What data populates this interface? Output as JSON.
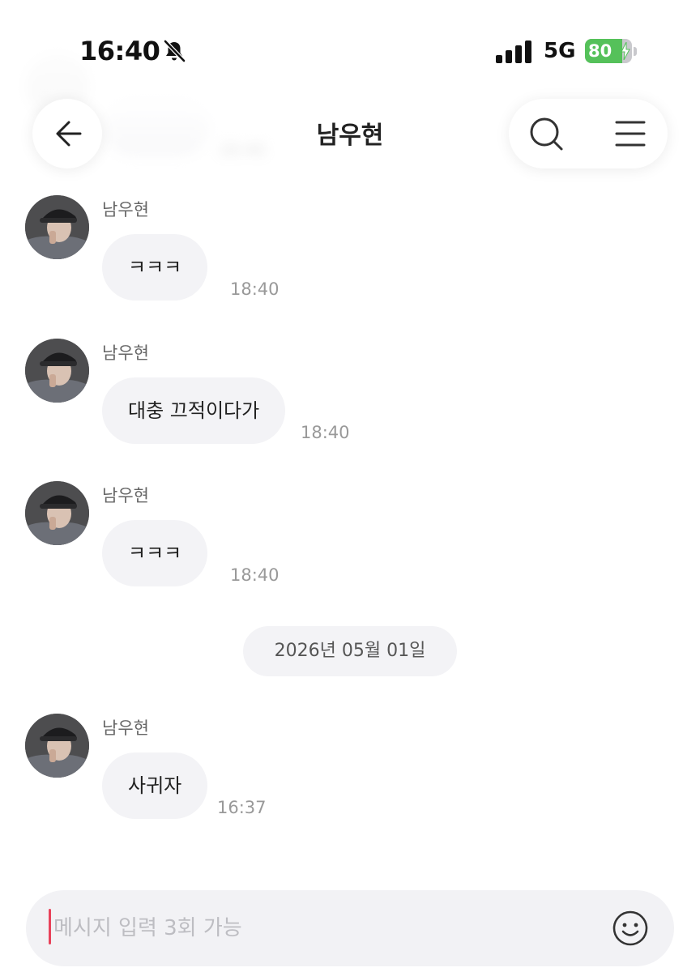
{
  "status_bar": {
    "time": "16:40",
    "network": "5G",
    "battery_level": "80",
    "icons": [
      "bell-slash-icon",
      "signal-icon",
      "battery-charging-icon"
    ]
  },
  "header": {
    "title": "남우현",
    "back_icon": "arrow-left-icon",
    "search_icon": "search-icon",
    "menu_icon": "hamburger-menu-icon"
  },
  "messages": [
    {
      "sender": "남우현",
      "text": "ㅋㅋㅋ",
      "time": "18:40"
    },
    {
      "sender": "남우현",
      "text": "대충 끄적이다가",
      "time": "18:40"
    },
    {
      "sender": "남우현",
      "text": "ㅋㅋㅋ",
      "time": "18:40"
    },
    {
      "sender": "남우현",
      "text": "사귀자",
      "time": "16:37"
    }
  ],
  "date_divider": "2026년 05월 01일",
  "input": {
    "placeholder": "메시지 입력 3회 가능",
    "emoji_icon": "smiley-icon"
  },
  "colors": {
    "bubble_bg": "#f3f3f6",
    "battery_green": "#55c15a",
    "caret": "#e8425a"
  }
}
